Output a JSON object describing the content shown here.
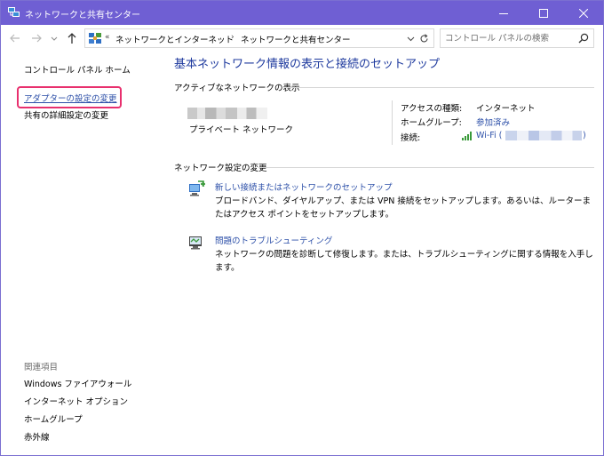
{
  "window": {
    "title": "ネットワークと共有センター",
    "accent_color": "#6f5fd3",
    "icons": [
      "network-app-icon",
      "minimize-icon",
      "maximize-icon",
      "close-icon"
    ]
  },
  "nav": {
    "breadcrumb_prefix": "«",
    "breadcrumb": [
      "ネットワークとインターネット",
      "ネットワークと共有センター"
    ],
    "search_placeholder": "コントロール パネルの検索",
    "icons": [
      "back-arrow-icon",
      "forward-arrow-icon",
      "recent-chevron-icon",
      "up-arrow-icon",
      "control-panel-icon",
      "chevron-down-icon",
      "refresh-icon",
      "search-icon"
    ]
  },
  "sidebar": {
    "home": "コントロール パネル ホーム",
    "items": [
      "アダプターの設定の変更",
      "共有の詳細設定の変更"
    ],
    "highlight_color": "#e8306e",
    "related_heading": "関連項目",
    "related": [
      "Windows ファイアウォール",
      "インターネット オプション",
      "ホームグループ",
      "赤外線"
    ]
  },
  "main": {
    "title": "基本ネットワーク情報の表示と接続のセットアップ",
    "active_heading": "アクティブなネットワークの表示",
    "network_type": "プライベート ネットワーク",
    "access_type_label": "アクセスの種類:",
    "access_type_value": "インターネット",
    "homegroup_label": "ホームグループ:",
    "homegroup_value": "参加済み",
    "connection_label": "接続:",
    "connection_value": "Wi-Fi (",
    "connection_suffix": ")",
    "settings_heading": "ネットワーク設定の変更",
    "tasks": [
      {
        "link": "新しい接続またはネットワークのセットアップ",
        "desc": "ブロードバンド、ダイヤルアップ、または VPN 接続をセットアップします。あるいは、ルーターまたはアクセス ポイントをセットアップします。",
        "icon": "new-connection-icon"
      },
      {
        "link": "問題のトラブルシューティング",
        "desc": "ネットワークの問題を診断して修復します。または、トラブルシューティングに関する情報を入手します。",
        "icon": "troubleshoot-icon"
      }
    ]
  }
}
